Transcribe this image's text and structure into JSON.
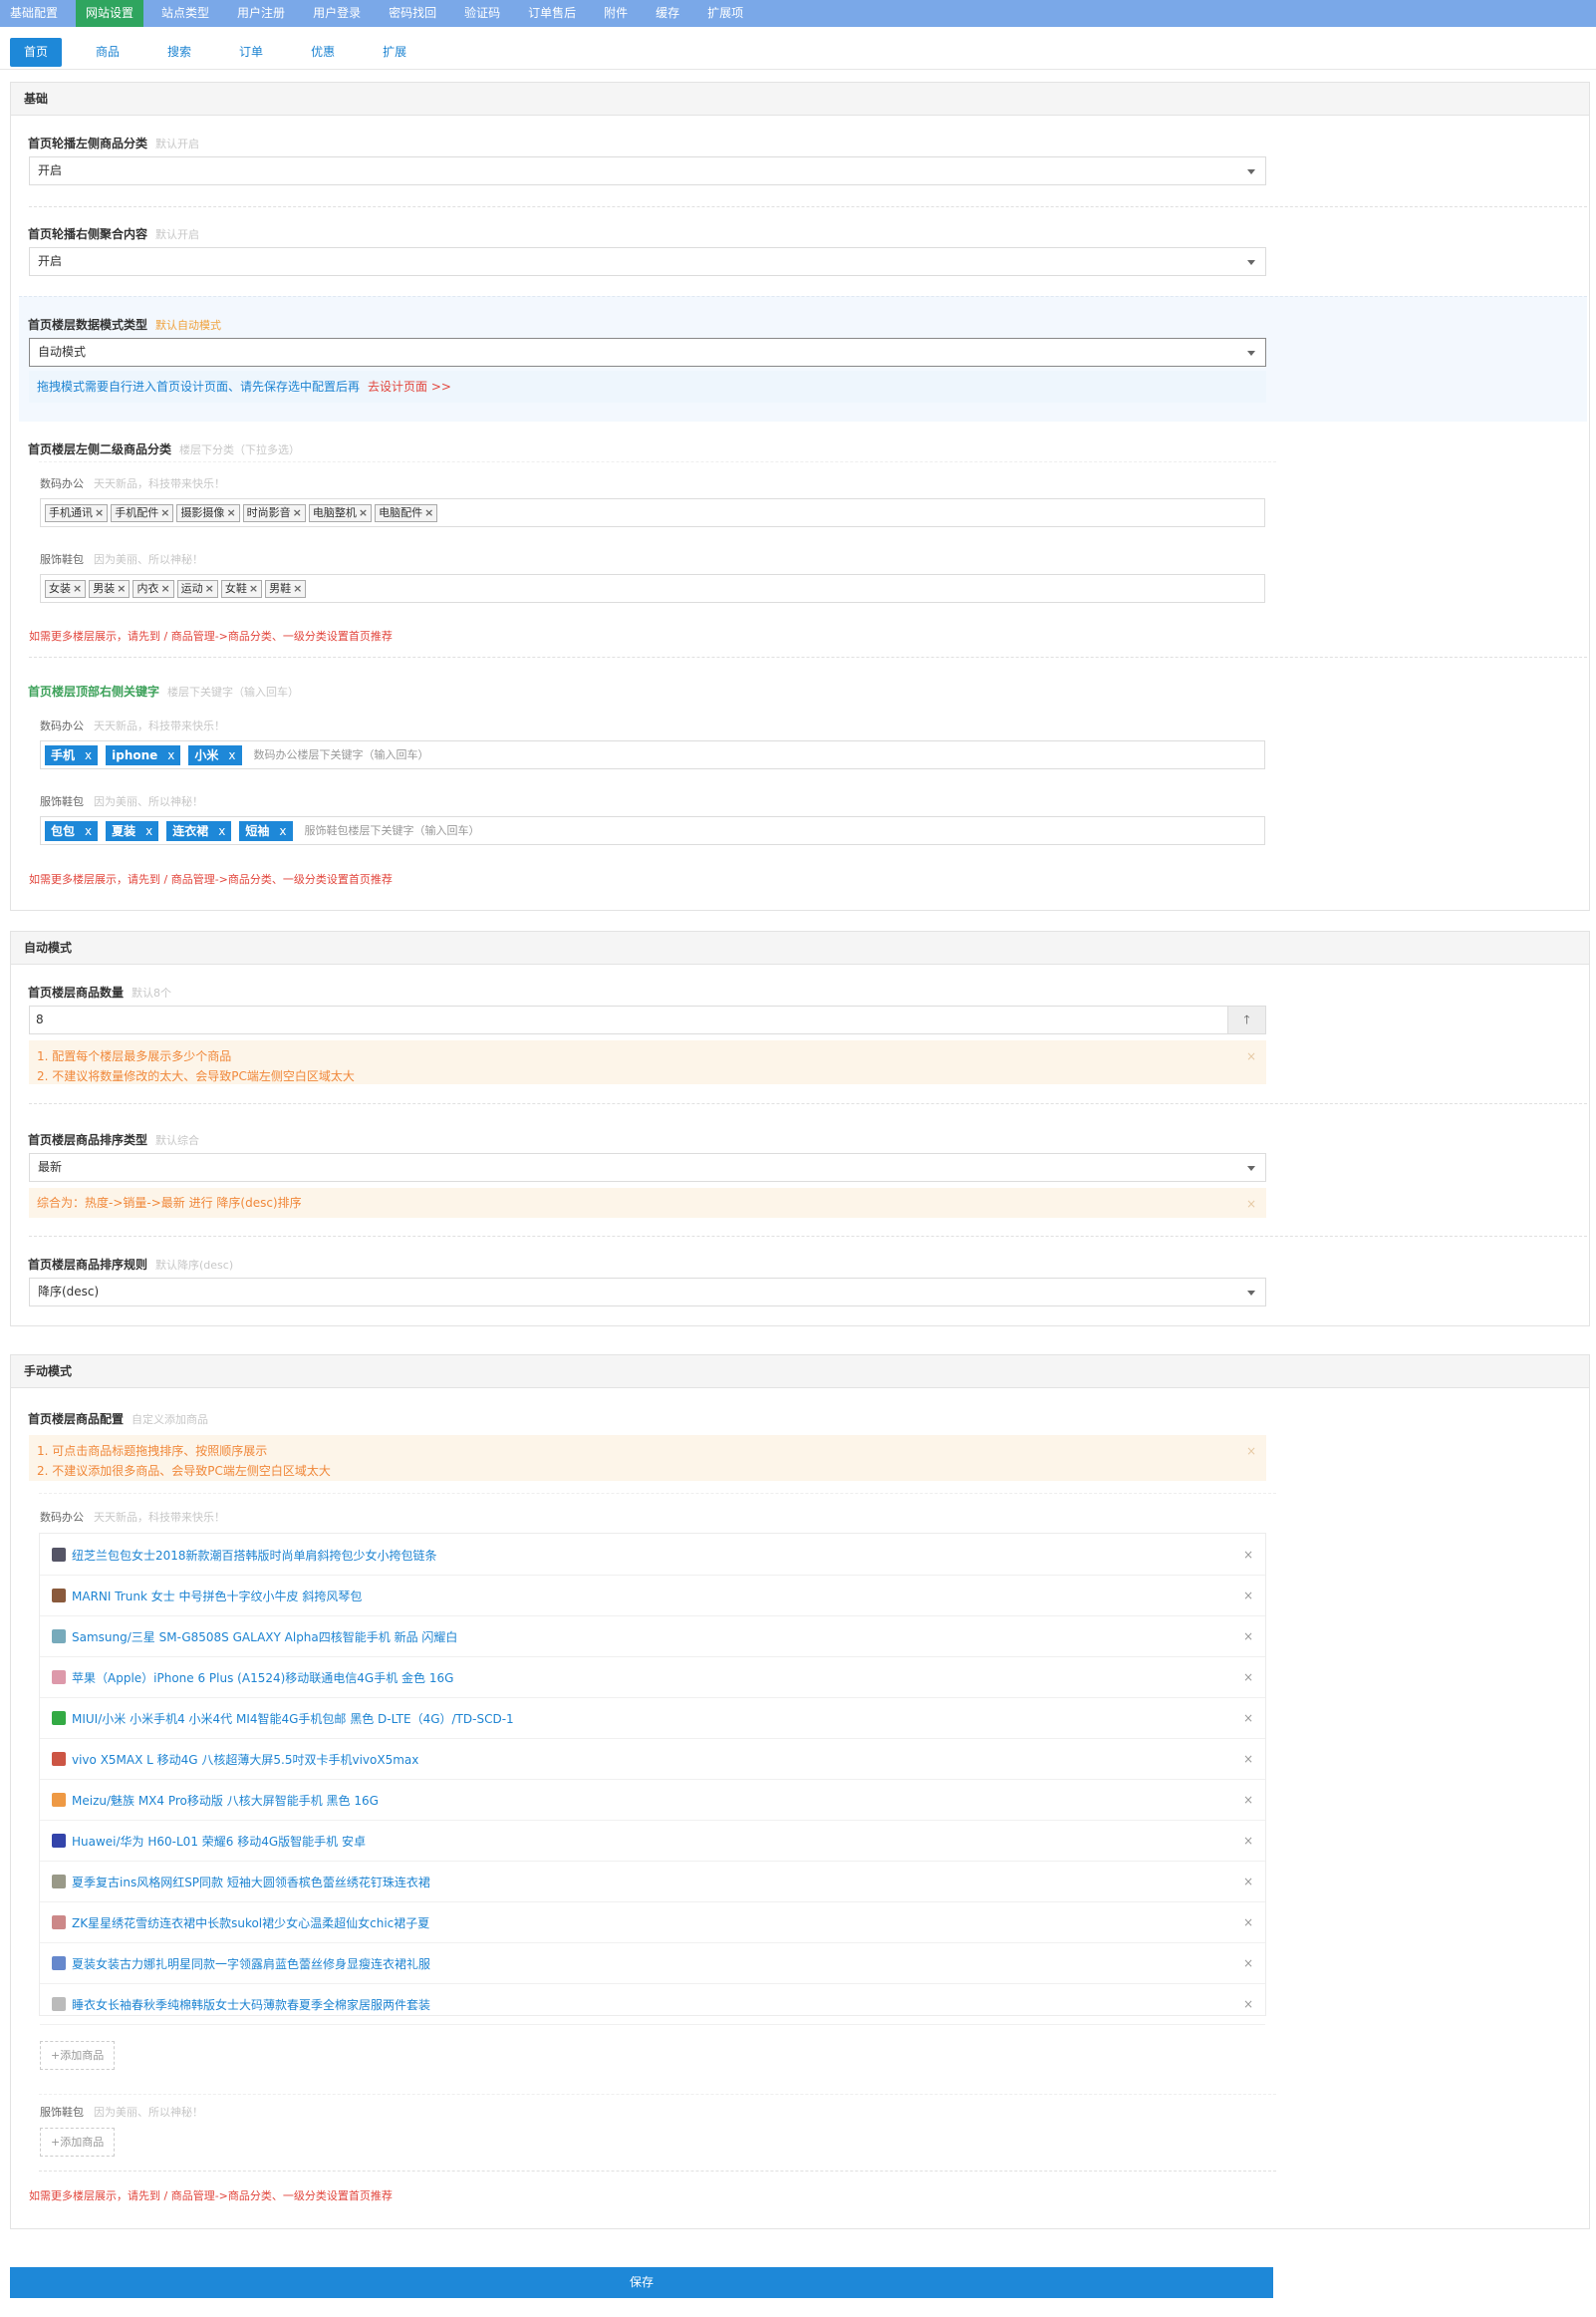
{
  "topnav": [
    "基础配置",
    "网站设置",
    "站点类型",
    "用户注册",
    "用户登录",
    "密码找回",
    "验证码",
    "订单售后",
    "附件",
    "缓存",
    "扩展项"
  ],
  "subtabs": [
    "首页",
    "商品",
    "搜索",
    "订单",
    "优惠",
    "扩展"
  ],
  "basic": {
    "title": "基础",
    "f1": {
      "label": "首页轮播左侧商品分类",
      "tip": "默认开启",
      "value": "开启"
    },
    "f2": {
      "label": "首页轮播右侧聚合内容",
      "tip": "默认开启",
      "value": "开启"
    },
    "f3": {
      "label": "首页楼层数据模式类型",
      "tip": "默认自动模式",
      "value": "自动模式",
      "info": "拖拽模式需要自行进入首页设计页面、请先保存选中配置后再",
      "link": "去设计页面 >>"
    },
    "f4": {
      "label": "首页楼层左侧二级商品分类",
      "tip": "楼层下分类（下拉多选）",
      "cat1": {
        "name": "数码办公",
        "desc": "天天新品，科技带来快乐！",
        "tags": [
          "手机通讯",
          "手机配件",
          "摄影摄像",
          "时尚影音",
          "电脑整机",
          "电脑配件"
        ]
      },
      "cat2": {
        "name": "服饰鞋包",
        "desc": "因为美丽、所以神秘！",
        "tags": [
          "女装",
          "男装",
          "内衣",
          "运动",
          "女鞋",
          "男鞋"
        ]
      },
      "note": "如需更多楼层展示，请先到 / 商品管理->商品分类、一级分类设置首页推荐"
    },
    "f5": {
      "label": "首页楼层顶部右侧关键字",
      "tip": "楼层下关键字（输入回车）",
      "cat1": {
        "name": "数码办公",
        "desc": "天天新品，科技带来快乐！",
        "tags": [
          "手机",
          "iphone",
          "小米"
        ],
        "placeholder": "数码办公楼层下关键字（输入回车）"
      },
      "cat2": {
        "name": "服饰鞋包",
        "desc": "因为美丽、所以神秘！",
        "tags": [
          "包包",
          "夏装",
          "连衣裙",
          "短袖"
        ],
        "placeholder": "服饰鞋包楼层下关键字（输入回车）"
      },
      "note": "如需更多楼层展示，请先到 / 商品管理->商品分类、一级分类设置首页推荐"
    }
  },
  "auto": {
    "title": "自动模式",
    "f1": {
      "label": "首页楼层商品数量",
      "tip": "默认8个",
      "value": "8",
      "warn1": "1. 配置每个楼层最多展示多少个商品",
      "warn2": "2. 不建议将数量修改的太大、会导致PC端左侧空白区域太大",
      "close": "×",
      "up": "🡑"
    },
    "f2": {
      "label": "首页楼层商品排序类型",
      "tip": "默认综合",
      "value": "最新",
      "warn": "综合为：热度->销量->最新 进行 降序(desc)排序",
      "close": "×"
    },
    "f3": {
      "label": "首页楼层商品排序规则",
      "tip": "默认降序(desc)",
      "value": "降序(desc)"
    }
  },
  "manual": {
    "title": "手动模式",
    "label": "首页楼层商品配置",
    "tip": "自定义添加商品",
    "warn1": "1. 可点击商品标题拖拽排序、按照顺序展示",
    "warn2": "2. 不建议添加很多商品、会导致PC端左侧空白区域太大",
    "close": "×",
    "cat1": {
      "name": "数码办公",
      "desc": "天天新品，科技带来快乐！"
    },
    "goods": [
      {
        "name": "纽芝兰包包女士2018新款潮百搭韩版时尚单肩斜挎包少女小挎包链条",
        "color": "#556"
      },
      {
        "name": "MARNI Trunk 女士 中号拼色十字纹小牛皮 斜挎风琴包",
        "color": "#8a5a3c"
      },
      {
        "name": "Samsung/三星 SM-G8508S GALAXY Alpha四核智能手机 新品 闪耀白",
        "color": "#7ab"
      },
      {
        "name": "苹果（Apple）iPhone 6 Plus (A1524)移动联通电信4G手机 金色 16G",
        "color": "#d9a"
      },
      {
        "name": "MIUI/小米 小米手机4 小米4代 MI4智能4G手机包邮 黑色 D-LTE（4G）/TD-SCD-1",
        "color": "#3a4"
      },
      {
        "name": "vivo X5MAX L 移动4G 八核超薄大屏5.5吋双卡手机vivoX5max",
        "color": "#c54"
      },
      {
        "name": "Meizu/魅族 MX4 Pro移动版 八核大屏智能手机 黑色 16G",
        "color": "#e94"
      },
      {
        "name": "Huawei/华为 H60-L01 荣耀6 移动4G版智能手机 安卓",
        "color": "#34a"
      },
      {
        "name": "夏季复古ins风格网红SP同款 短袖大圆领香槟色蕾丝绣花钉珠连衣裙",
        "color": "#998"
      },
      {
        "name": "ZK星星绣花雪纺连衣裙中长款sukol裙少女心温柔超仙女chic裙子夏",
        "color": "#c88"
      },
      {
        "name": "夏装女装古力娜扎明星同款一字领露肩蓝色蕾丝修身显瘦连衣裙礼服",
        "color": "#68c"
      },
      {
        "name": "睡衣女长袖春秋季纯棉韩版女士大码薄款春夏季全棉家居服两件套装",
        "color": "#bbb"
      }
    ],
    "del": "×",
    "add": "+添加商品",
    "cat2": {
      "name": "服饰鞋包",
      "desc": "因为美丽、所以神秘！"
    },
    "note": "如需更多楼层展示，请先到 / 商品管理->商品分类、一级分类设置首页推荐"
  },
  "save": "保存"
}
